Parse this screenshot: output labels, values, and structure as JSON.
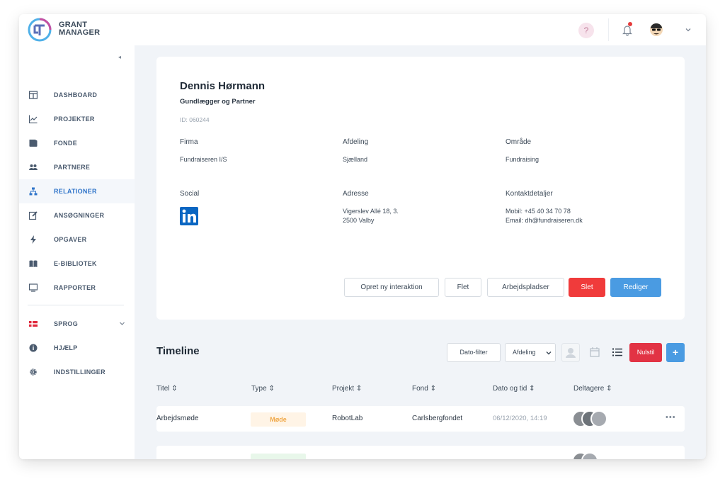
{
  "brand": {
    "name_line1": "GRANT",
    "name_line2": "MANAGER"
  },
  "header": {
    "help_label": "?"
  },
  "sidebar": {
    "items": [
      {
        "label": "DASHBOARD",
        "icon": "dashboard-icon"
      },
      {
        "label": "PROJEKTER",
        "icon": "chart-icon"
      },
      {
        "label": "FONDE",
        "icon": "wallet-icon"
      },
      {
        "label": "PARTNERE",
        "icon": "users-icon"
      },
      {
        "label": "RELATIONER",
        "icon": "network-icon",
        "active": true
      },
      {
        "label": "ANSØGNINGER",
        "icon": "edit-icon"
      },
      {
        "label": "OPGAVER",
        "icon": "bolt-icon"
      },
      {
        "label": "E-BIBLIOTEK",
        "icon": "book-icon"
      },
      {
        "label": "RAPPORTER",
        "icon": "monitor-icon"
      }
    ],
    "bottom_items": [
      {
        "label": "SPROG",
        "icon": "danish-flag-icon"
      },
      {
        "label": "HJÆLP",
        "icon": "info-icon"
      },
      {
        "label": "INDSTILLINGER",
        "icon": "gear-icon"
      }
    ]
  },
  "profile": {
    "name": "Dennis Hørmann",
    "title": "Gundlægger og Partner",
    "id": "ID: 060244",
    "fields": {
      "firma_label": "Firma",
      "firma_value": "Fundraiseren I/S",
      "afdeling_label": "Afdeling",
      "afdeling_value": "Sjælland",
      "omraade_label": "Område",
      "omraade_value": "Fundraising",
      "social_label": "Social",
      "adresse_label": "Adresse",
      "adresse_line1": "Vigerslev Allé 18, 3.",
      "adresse_line2": "2500 Valby",
      "kontakt_label": "Kontaktdetaljer",
      "kontakt_line1": "Mobil: +45 40 34 70 78",
      "kontakt_line2": "Email: dh@fundraiseren.dk"
    },
    "actions": {
      "create": "Opret ny interaktion",
      "merge": "Flet",
      "workplaces": "Arbejdspladser",
      "delete": "Slet",
      "edit": "Rediger"
    }
  },
  "timeline": {
    "title": "Timeline",
    "toolbar": {
      "date_filter": "Dato-filter",
      "department": "Afdeling",
      "reset": "Nulstil",
      "add": "+"
    },
    "columns": [
      "Titel ⇕",
      "Type ⇕",
      "Projekt ⇕",
      "Fond ⇕",
      "Dato og tid ⇕",
      "Deltagere ⇕"
    ],
    "rows": [
      {
        "title": "Arbejdsmøde",
        "type": "Møde",
        "project": "RobotLab",
        "fund": "Carlsbergfondet",
        "datetime": "06/12/2020, 14:19",
        "more": "•••"
      }
    ]
  },
  "colors": {
    "accent": "#2f74c9",
    "danger": "#f03b3b",
    "primary": "#4a9be2",
    "reset": "#e23344",
    "badge_text": "#f0a848"
  }
}
